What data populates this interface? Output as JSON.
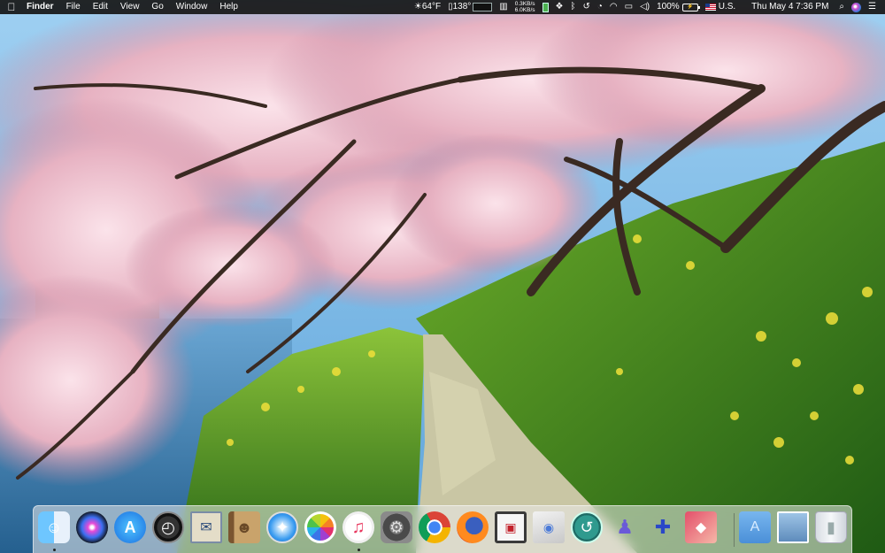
{
  "menubar": {
    "apple_icon": "apple-icon",
    "app_name": "Finder",
    "menus": [
      "File",
      "Edit",
      "View",
      "Go",
      "Window",
      "Help"
    ],
    "status": {
      "weather": "64°F",
      "temperature": "138°",
      "network_up": "0.3KB/s",
      "network_down": "6.0KB/s",
      "battery_percent": "100%",
      "input_source": "U.S.",
      "clock": "Thu May 4  7:36 PM"
    }
  },
  "dock": {
    "items": [
      {
        "name": "finder",
        "glyph": "☺",
        "running": true
      },
      {
        "name": "siri",
        "glyph": "",
        "running": false
      },
      {
        "name": "app-store",
        "glyph": "A",
        "running": false
      },
      {
        "name": "dashboard",
        "glyph": "◴",
        "running": false
      },
      {
        "name": "mail",
        "glyph": "✉",
        "running": false
      },
      {
        "name": "contacts",
        "glyph": "☻",
        "running": false
      },
      {
        "name": "safari",
        "glyph": "✦",
        "running": false
      },
      {
        "name": "photos",
        "glyph": "",
        "running": false
      },
      {
        "name": "itunes",
        "glyph": "♫",
        "running": true
      },
      {
        "name": "system-preferences",
        "glyph": "⚙",
        "running": false
      },
      {
        "name": "chrome",
        "glyph": "",
        "running": false
      },
      {
        "name": "firefox",
        "glyph": "",
        "running": false
      },
      {
        "name": "photo-booth",
        "glyph": "▣",
        "running": false
      },
      {
        "name": "preview",
        "glyph": "◉",
        "running": false
      },
      {
        "name": "time-machine",
        "glyph": "↺",
        "running": false
      },
      {
        "name": "migration-assistant",
        "glyph": "♟",
        "running": false
      },
      {
        "name": "chess",
        "glyph": "✚",
        "running": false
      },
      {
        "name": "sequel-pro",
        "glyph": "◆",
        "running": false
      }
    ],
    "right_items": [
      {
        "name": "applications-folder",
        "glyph": "A"
      },
      {
        "name": "downloads-stack",
        "glyph": ""
      },
      {
        "name": "trash",
        "glyph": "▮"
      }
    ]
  },
  "wallpaper_colors": {
    "sky": "#6fb4e6",
    "blossom": "#f2c6d2",
    "grass": "#3f8f22",
    "flowers": "#e6d83a",
    "path": "#b9b89a",
    "water": "#3f7fb3"
  }
}
